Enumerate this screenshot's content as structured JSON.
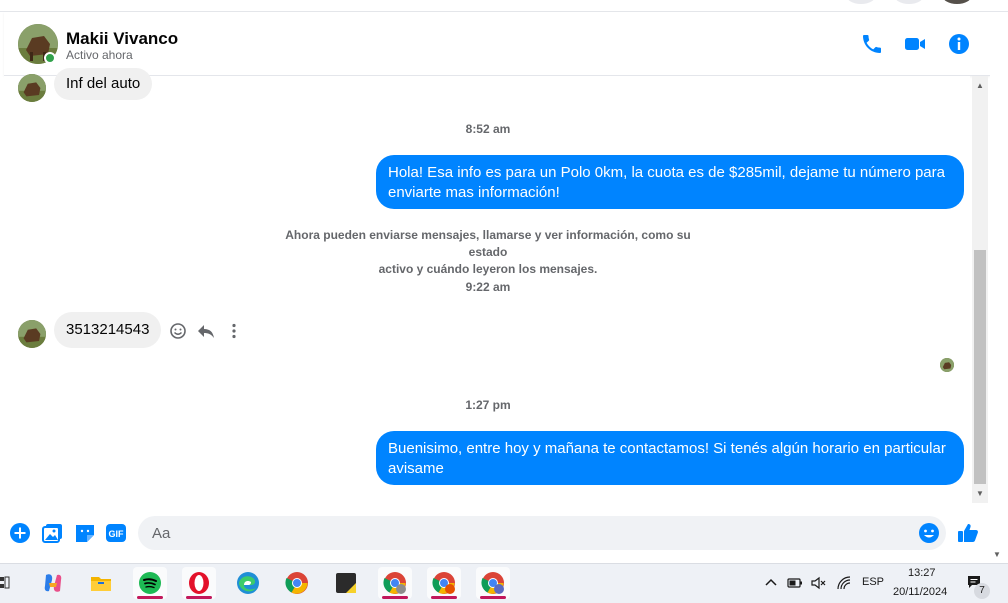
{
  "header": {
    "name": "Makii Vivanco",
    "status": "Activo ahora"
  },
  "messages": {
    "first_in": "Inf del auto",
    "ts1": "8:52 am",
    "out1": "Hola! Esa info es para un Polo 0km, la cuota es de $285mil, dejame tu número para enviarte mas información!",
    "system_line1": "Ahora pueden enviarse mensajes, llamarse y ver información, como su estado",
    "system_line2": "activo y cuándo leyeron los mensajes.",
    "ts2": "9:22 am",
    "in2": "3513214543",
    "ts3": "1:27 pm",
    "out2": "Buenisimo, entre hoy y mañana te contactamos! Si tenés algún horario en particular avisame"
  },
  "composer": {
    "placeholder": "Aa"
  },
  "taskbar": {
    "apps": [
      "copilot-icon",
      "file-explorer-icon",
      "spotify-icon",
      "opera-icon",
      "edge-icon",
      "chrome-icon",
      "sticky-notes-icon",
      "chrome-profile-y-icon",
      "chrome-profile-r-icon",
      "chrome-profile-c-icon"
    ],
    "language": "ESP",
    "time": "13:27",
    "date": "20/11/2024",
    "notification_count": "7"
  },
  "colors": {
    "accent": "#0084ff",
    "incoming_bubble": "#f0f0f0",
    "online": "#31a24c"
  }
}
